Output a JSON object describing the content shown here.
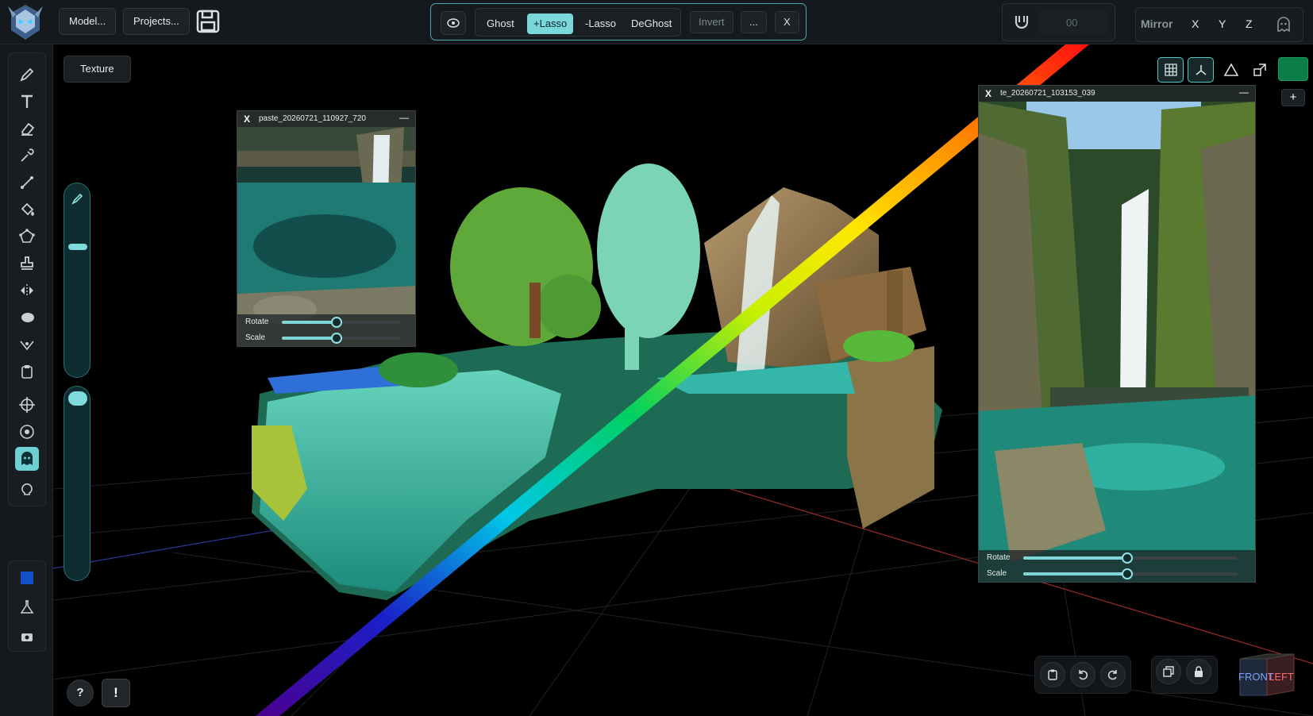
{
  "topbar": {
    "model_label": "Model...",
    "projects_label": "Projects...",
    "ghost_label": "Ghost",
    "lasso_add_label": "+Lasso",
    "lasso_sub_label": "-Lasso",
    "deghost_label": "DeGhost",
    "invert_label": "Invert",
    "more_label": "...",
    "close_label": "X",
    "magnet_value": "00",
    "mirror_label": "Mirror",
    "mirror_x": "X",
    "mirror_y": "Y",
    "mirror_z": "Z"
  },
  "left_panel": {
    "texture_label": "Texture",
    "help_label": "?",
    "alert_label": "!",
    "brush_size_slider": 0.14,
    "opacity_slider": 0.02
  },
  "ref_left": {
    "close": "X",
    "minimize": "—",
    "title": "paste_20260721_110927_720",
    "rotate_label": "Rotate",
    "scale_label": "Scale",
    "rotate_value": 0.45,
    "scale_value": 0.45
  },
  "ref_right": {
    "close": "X",
    "minimize": "—",
    "title": "te_20260721_103153_039",
    "rotate_label": "Rotate",
    "scale_label": "Scale",
    "rotate_value": 0.48,
    "scale_value": 0.48
  },
  "view_buttons": {
    "add_label": "+",
    "color": "#0d7e4a"
  },
  "view_cube": {
    "front": "FRONT",
    "left": "LEFT"
  },
  "colors": {
    "accent": "#6ed0d3",
    "panel_bg": "#15191d"
  }
}
